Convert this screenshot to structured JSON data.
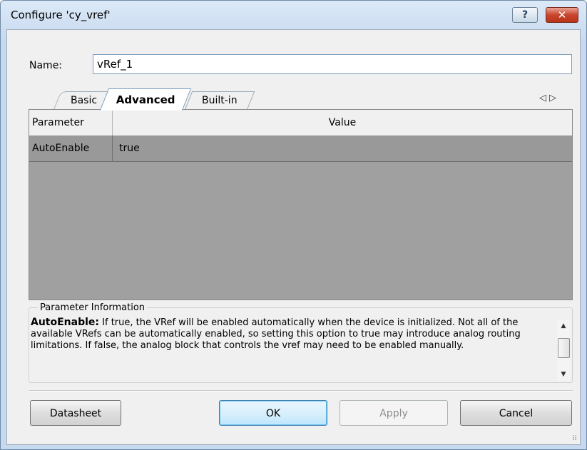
{
  "window": {
    "title": "Configure 'cy_vref'"
  },
  "titlebar": {
    "help_glyph": "?",
    "close_glyph": "✕"
  },
  "name_field": {
    "label": "Name:",
    "value": "vRef_1"
  },
  "tabs": [
    {
      "label": "Basic"
    },
    {
      "label": "Advanced",
      "selected": true
    },
    {
      "label": "Built-in"
    }
  ],
  "tab_arrows": "◁▷",
  "grid": {
    "headers": {
      "parameter": "Parameter",
      "value": "Value"
    },
    "rows": [
      {
        "parameter": "AutoEnable",
        "value": "true"
      }
    ]
  },
  "info": {
    "legend": "Parameter Information",
    "param_name": "AutoEnable:",
    "description": "If true, the VRef will be enabled automatically when the device is initialized. Not all of the available VRefs can be automatically enabled, so setting this option to true may introduce analog routing limitations. If false, the analog block that controls the vref may need to be enabled manually."
  },
  "buttons": {
    "datasheet": "Datasheet",
    "ok": "OK",
    "apply": "Apply",
    "cancel": "Cancel"
  },
  "colors": {
    "title_close": "#c8452e",
    "grid_background": "#a0a0a0",
    "row_selected": "#999999"
  }
}
